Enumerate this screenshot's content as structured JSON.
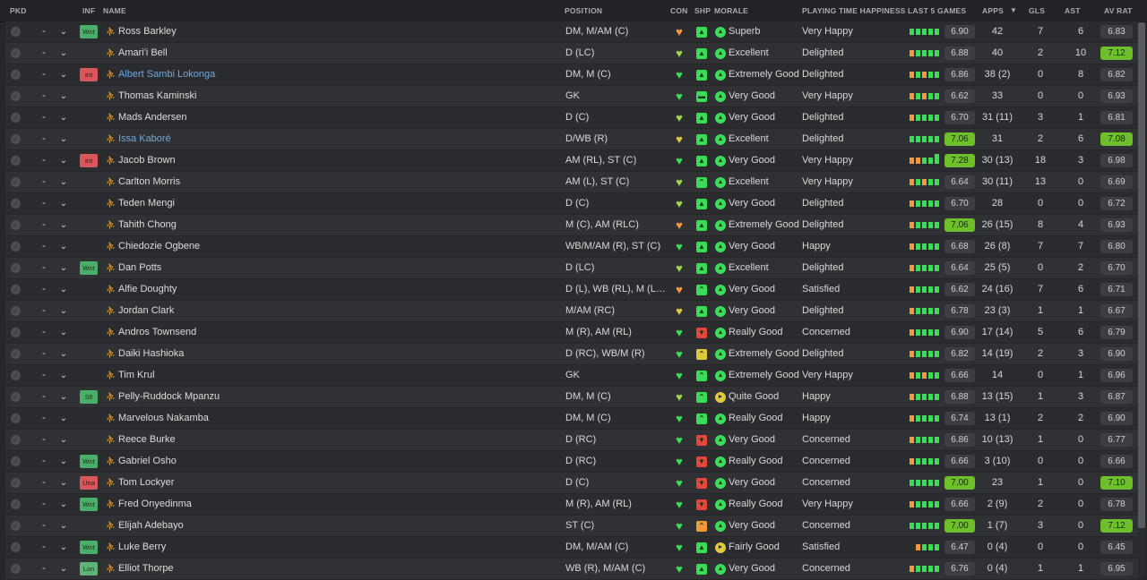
{
  "headers": {
    "pkd": "PKD",
    "inf": "INF",
    "name": "NAME",
    "position": "POSITION",
    "con": "CON",
    "shp": "SHP",
    "morale": "MORALE",
    "playing_time": "PLAYING TIME HAPPINESS",
    "last5": "LAST 5 GAMES",
    "apps": "APPS",
    "sort_icon": "caret-down-icon",
    "gls": "GLS",
    "ast": "AST",
    "av_rat": "AV RAT"
  },
  "colors": {
    "green": "#3ddc58",
    "lime": "#9bd64a",
    "yellow": "#e1c93c",
    "orange": "#f29a3a",
    "red": "#e5483b",
    "link_blue": "#6fa8dc",
    "rating_high_bg": "#6fbf2a"
  },
  "players": [
    {
      "inf": "Wnt",
      "name": "Ross Barkley",
      "link": false,
      "position": "DM, M/AM (C)",
      "con": "orange",
      "shp": "up",
      "morale": "Superb",
      "morale_icon": "up",
      "pt": "Very Happy",
      "last5": [
        "g",
        "g",
        "g",
        "g",
        "g"
      ],
      "l5": "6.90",
      "l5_high": false,
      "apps": "42",
      "gls": "7",
      "ast": "6",
      "av": "6.83",
      "av_high": false
    },
    {
      "inf": "",
      "name": "Amari'i Bell",
      "link": false,
      "position": "D (LC)",
      "con": "lime",
      "shp": "up",
      "morale": "Excellent",
      "morale_icon": "up",
      "pt": "Delighted",
      "last5": [
        "o",
        "g",
        "g",
        "g",
        "g"
      ],
      "l5": "6.88",
      "l5_high": false,
      "apps": "40",
      "gls": "2",
      "ast": "10",
      "av": "7.12",
      "av_high": true
    },
    {
      "inf": "Int",
      "name": "Albert Sambi Lokonga",
      "link": true,
      "position": "DM, M (C)",
      "con": "green",
      "shp": "up",
      "morale": "Extremely Good",
      "morale_icon": "up",
      "pt": "Delighted",
      "last5": [
        "o",
        "g",
        "o",
        "g",
        "g"
      ],
      "l5": "6.86",
      "l5_high": false,
      "apps": "38 (2)",
      "gls": "0",
      "ast": "8",
      "av": "6.82",
      "av_high": false
    },
    {
      "inf": "",
      "name": "Thomas Kaminski",
      "link": false,
      "position": "GK",
      "con": "green",
      "shp": "flat",
      "morale": "Very Good",
      "morale_icon": "up",
      "pt": "Very Happy",
      "last5": [
        "o",
        "g",
        "o",
        "g",
        "g"
      ],
      "l5": "6.62",
      "l5_high": false,
      "apps": "33",
      "gls": "0",
      "ast": "0",
      "av": "6.93",
      "av_high": false
    },
    {
      "inf": "",
      "name": "Mads Andersen",
      "link": false,
      "position": "D (C)",
      "con": "lime",
      "shp": "up",
      "morale": "Very Good",
      "morale_icon": "up",
      "pt": "Delighted",
      "last5": [
        "o",
        "g",
        "g",
        "g",
        "g"
      ],
      "l5": "6.70",
      "l5_high": false,
      "apps": "31 (11)",
      "gls": "3",
      "ast": "1",
      "av": "6.81",
      "av_high": false
    },
    {
      "inf": "",
      "name": "Issa Kaboré",
      "link": true,
      "position": "D/WB (R)",
      "con": "yellow",
      "shp": "up",
      "morale": "Excellent",
      "morale_icon": "up",
      "pt": "Delighted",
      "last5": [
        "g",
        "g",
        "g",
        "g",
        "g"
      ],
      "l5": "7.06",
      "l5_high": true,
      "apps": "31",
      "gls": "2",
      "ast": "6",
      "av": "7.08",
      "av_high": true
    },
    {
      "inf": "Int",
      "name": "Jacob Brown",
      "link": false,
      "position": "AM (RL), ST (C)",
      "con": "green",
      "shp": "up",
      "morale": "Very Good",
      "morale_icon": "up",
      "pt": "Very Happy",
      "last5": [
        "o",
        "o",
        "g",
        "g",
        "G"
      ],
      "l5": "7.28",
      "l5_high": true,
      "apps": "30 (13)",
      "gls": "18",
      "ast": "3",
      "av": "6.98",
      "av_high": false
    },
    {
      "inf": "",
      "name": "Carlton Morris",
      "link": false,
      "position": "AM (L), ST (C)",
      "con": "lime",
      "shp": "up2",
      "morale": "Excellent",
      "morale_icon": "up",
      "pt": "Very Happy",
      "last5": [
        "o",
        "g",
        "o",
        "g",
        "g"
      ],
      "l5": "6.64",
      "l5_high": false,
      "apps": "30 (11)",
      "gls": "13",
      "ast": "0",
      "av": "6.69",
      "av_high": false
    },
    {
      "inf": "",
      "name": "Teden Mengi",
      "link": false,
      "position": "D (C)",
      "con": "lime",
      "shp": "up",
      "morale": "Very Good",
      "morale_icon": "up",
      "pt": "Delighted",
      "last5": [
        "o",
        "g",
        "g",
        "g",
        "g"
      ],
      "l5": "6.70",
      "l5_high": false,
      "apps": "28",
      "gls": "0",
      "ast": "0",
      "av": "6.72",
      "av_high": false
    },
    {
      "inf": "",
      "name": "Tahith Chong",
      "link": false,
      "position": "M (C), AM (RLC)",
      "con": "orange",
      "shp": "up",
      "morale": "Extremely Good",
      "morale_icon": "up",
      "pt": "Delighted",
      "last5": [
        "o",
        "g",
        "g",
        "g",
        "g"
      ],
      "l5": "7.06",
      "l5_high": true,
      "apps": "26 (15)",
      "gls": "8",
      "ast": "4",
      "av": "6.93",
      "av_high": false
    },
    {
      "inf": "",
      "name": "Chiedozie Ogbene",
      "link": false,
      "position": "WB/M/AM (R), ST (C)",
      "con": "green",
      "shp": "up",
      "morale": "Very Good",
      "morale_icon": "up",
      "pt": "Happy",
      "last5": [
        "o",
        "g",
        "g",
        "g",
        "g"
      ],
      "l5": "6.68",
      "l5_high": false,
      "apps": "26 (8)",
      "gls": "7",
      "ast": "7",
      "av": "6.80",
      "av_high": false
    },
    {
      "inf": "Wnt",
      "name": "Dan Potts",
      "link": false,
      "position": "D (LC)",
      "con": "lime",
      "shp": "up",
      "morale": "Excellent",
      "morale_icon": "up",
      "pt": "Delighted",
      "last5": [
        "o",
        "g",
        "g",
        "g",
        "g"
      ],
      "l5": "6.64",
      "l5_high": false,
      "apps": "25 (5)",
      "gls": "0",
      "ast": "2",
      "av": "6.70",
      "av_high": false
    },
    {
      "inf": "",
      "name": "Alfie Doughty",
      "link": false,
      "position": "D (L), WB (RL), M (L),...",
      "con": "orange",
      "shp": "up2",
      "morale": "Very Good",
      "morale_icon": "up",
      "pt": "Satisfied",
      "last5": [
        "o",
        "g",
        "g",
        "g",
        "g"
      ],
      "l5": "6.62",
      "l5_high": false,
      "apps": "24 (16)",
      "gls": "7",
      "ast": "6",
      "av": "6.71",
      "av_high": false
    },
    {
      "inf": "",
      "name": "Jordan Clark",
      "link": false,
      "position": "M/AM (RC)",
      "con": "yellow",
      "shp": "up",
      "morale": "Very Good",
      "morale_icon": "up",
      "pt": "Delighted",
      "last5": [
        "o",
        "g",
        "g",
        "g",
        "g"
      ],
      "l5": "6.78",
      "l5_high": false,
      "apps": "23 (3)",
      "gls": "1",
      "ast": "1",
      "av": "6.67",
      "av_high": false
    },
    {
      "inf": "",
      "name": "Andros Townsend",
      "link": false,
      "position": "M (R), AM (RL)",
      "con": "green",
      "shp": "down",
      "morale": "Really Good",
      "morale_icon": "up",
      "pt": "Concerned",
      "last5": [
        "o",
        "g",
        "g",
        "g",
        "g"
      ],
      "l5": "6.90",
      "l5_high": false,
      "apps": "17 (14)",
      "gls": "5",
      "ast": "6",
      "av": "6.79",
      "av_high": false
    },
    {
      "inf": "",
      "name": "Daiki Hashioka",
      "link": false,
      "position": "D (RC), WB/M (R)",
      "con": "green",
      "shp": "up2y",
      "morale": "Extremely Good",
      "morale_icon": "up",
      "pt": "Delighted",
      "last5": [
        "o",
        "g",
        "g",
        "g",
        "g"
      ],
      "l5": "6.82",
      "l5_high": false,
      "apps": "14 (19)",
      "gls": "2",
      "ast": "3",
      "av": "6.90",
      "av_high": false
    },
    {
      "inf": "",
      "name": "Tim Krul",
      "link": false,
      "position": "GK",
      "con": "green",
      "shp": "up2",
      "morale": "Extremely Good",
      "morale_icon": "up",
      "pt": "Very Happy",
      "last5": [
        "o",
        "g",
        "o",
        "g",
        "g"
      ],
      "l5": "6.66",
      "l5_high": false,
      "apps": "14",
      "gls": "0",
      "ast": "1",
      "av": "6.96",
      "av_high": false
    },
    {
      "inf": "Slt",
      "name": "Pelly-Ruddock Mpanzu",
      "link": false,
      "position": "DM, M (C)",
      "con": "lime",
      "shp": "up2",
      "morale": "Quite Good",
      "morale_icon": "right",
      "pt": "Happy",
      "last5": [
        "o",
        "g",
        "g",
        "g",
        "g"
      ],
      "l5": "6.88",
      "l5_high": false,
      "apps": "13 (15)",
      "gls": "1",
      "ast": "3",
      "av": "6.87",
      "av_high": false
    },
    {
      "inf": "",
      "name": "Marvelous Nakamba",
      "link": false,
      "position": "DM, M (C)",
      "con": "green",
      "shp": "up2",
      "morale": "Really Good",
      "morale_icon": "up",
      "pt": "Happy",
      "last5": [
        "o",
        "g",
        "g",
        "g",
        "g"
      ],
      "l5": "6.74",
      "l5_high": false,
      "apps": "13 (1)",
      "gls": "2",
      "ast": "2",
      "av": "6.90",
      "av_high": false
    },
    {
      "inf": "",
      "name": "Reece Burke",
      "link": false,
      "position": "D (RC)",
      "con": "green",
      "shp": "down",
      "morale": "Very Good",
      "morale_icon": "up",
      "pt": "Concerned",
      "last5": [
        "o",
        "g",
        "g",
        "g",
        "g"
      ],
      "l5": "6.86",
      "l5_high": false,
      "apps": "10 (13)",
      "gls": "1",
      "ast": "0",
      "av": "6.77",
      "av_high": false
    },
    {
      "inf": "Wnt",
      "name": "Gabriel Osho",
      "link": false,
      "position": "D (RC)",
      "con": "green",
      "shp": "down",
      "morale": "Really Good",
      "morale_icon": "up",
      "pt": "Concerned",
      "last5": [
        "o",
        "g",
        "g",
        "g",
        "g"
      ],
      "l5": "6.66",
      "l5_high": false,
      "apps": "3 (10)",
      "gls": "0",
      "ast": "0",
      "av": "6.66",
      "av_high": false
    },
    {
      "inf": "Una",
      "name": "Tom Lockyer",
      "link": false,
      "position": "D (C)",
      "con": "green",
      "shp": "down",
      "morale": "Very Good",
      "morale_icon": "up",
      "pt": "Concerned",
      "last5": [
        "g",
        "g",
        "g",
        "g",
        "g"
      ],
      "l5": "7.00",
      "l5_high": true,
      "apps": "23",
      "gls": "1",
      "ast": "0",
      "av": "7.10",
      "av_high": true
    },
    {
      "inf": "Wnt",
      "name": "Fred Onyedinma",
      "link": false,
      "position": "M (R), AM (RL)",
      "con": "green",
      "shp": "down",
      "morale": "Really Good",
      "morale_icon": "up",
      "pt": "Very Happy",
      "last5": [
        "o",
        "g",
        "g",
        "g",
        "g"
      ],
      "l5": "6.66",
      "l5_high": false,
      "apps": "2 (9)",
      "gls": "2",
      "ast": "0",
      "av": "6.78",
      "av_high": false
    },
    {
      "inf": "",
      "name": "Elijah Adebayo",
      "link": false,
      "position": "ST (C)",
      "con": "green",
      "shp": "up2o",
      "morale": "Very Good",
      "morale_icon": "up",
      "pt": "Concerned",
      "last5": [
        "g",
        "g",
        "g",
        "g",
        "g"
      ],
      "l5": "7.00",
      "l5_high": true,
      "apps": "1 (7)",
      "gls": "3",
      "ast": "0",
      "av": "7.12",
      "av_high": true
    },
    {
      "inf": "Wnt",
      "name": "Luke Berry",
      "link": false,
      "position": "DM, M/AM (C)",
      "con": "green",
      "shp": "up",
      "morale": "Fairly Good",
      "morale_icon": "right",
      "pt": "Satisfied",
      "last5": [
        "",
        "o",
        "g",
        "g",
        "g"
      ],
      "l5": "6.47",
      "l5_high": false,
      "apps": "0 (4)",
      "gls": "0",
      "ast": "0",
      "av": "6.45",
      "av_high": false
    },
    {
      "inf": "Lon",
      "name": "Elliot Thorpe",
      "link": false,
      "position": "WB (R), M/AM (C)",
      "con": "green",
      "shp": "up",
      "morale": "Very Good",
      "morale_icon": "up",
      "pt": "Concerned",
      "last5": [
        "o",
        "g",
        "g",
        "g",
        "g"
      ],
      "l5": "6.76",
      "l5_high": false,
      "apps": "0 (4)",
      "gls": "1",
      "ast": "1",
      "av": "6.95",
      "av_high": false
    }
  ]
}
